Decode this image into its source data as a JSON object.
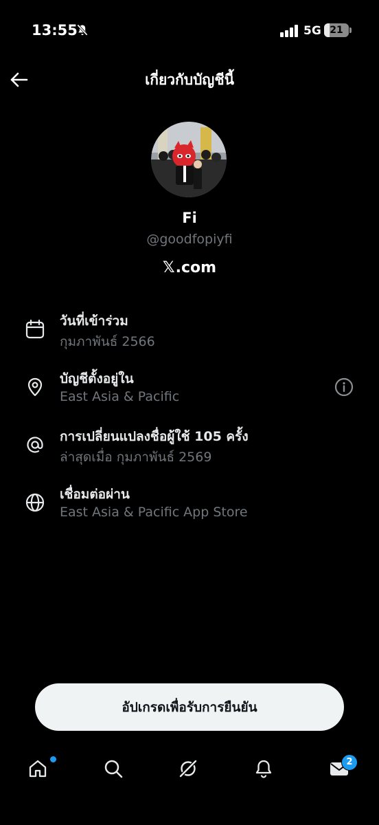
{
  "status_bar": {
    "time": "13:55",
    "mute_icon": "bell-slash-icon",
    "signal_icon": "cellular-signal-icon",
    "network": "5G",
    "battery_percent": 21
  },
  "header": {
    "back_icon": "arrow-left-icon",
    "title": "เกี่ยวกับบัญชีนี้"
  },
  "profile": {
    "avatar_icon": "profile-photo",
    "name": "Fi",
    "handle": "@goodfopiyfi",
    "site_glyph": "𝕏",
    "site_text": ".com"
  },
  "details": [
    {
      "icon": "calendar-icon",
      "title": "วันที่เข้าร่วม",
      "subtitle": "กุมภาพันธ์ 2566"
    },
    {
      "icon": "location-pin-icon",
      "title": "บัญชีตั้งอยู่ใน",
      "subtitle": "East Asia & Pacific",
      "action_icon": "info-circle-icon"
    },
    {
      "icon": "at-sign-icon",
      "title": "การเปลี่ยนแปลงชื่อผู้ใช้ 105 ครั้ง",
      "subtitle": "ล่าสุดเมื่อ กุมภาพันธ์ 2569"
    },
    {
      "icon": "globe-icon",
      "title": "เชื่อมต่อผ่าน",
      "subtitle": "East Asia & Pacific App Store"
    }
  ],
  "upgrade_button": {
    "label": "อัปเกรดเพื่อรับการยืนยัน"
  },
  "tab_bar": {
    "home_icon": "home-icon",
    "search_icon": "search-icon",
    "grok_icon": "grok-icon",
    "notifications_icon": "bell-icon",
    "messages_icon": "envelope-icon",
    "messages_badge": "2"
  },
  "colors": {
    "background": "#000000",
    "primary_text": "#e7e9ea",
    "secondary_text": "#71767b",
    "accent": "#1d9bf0",
    "button_bg": "#eff3f4"
  }
}
